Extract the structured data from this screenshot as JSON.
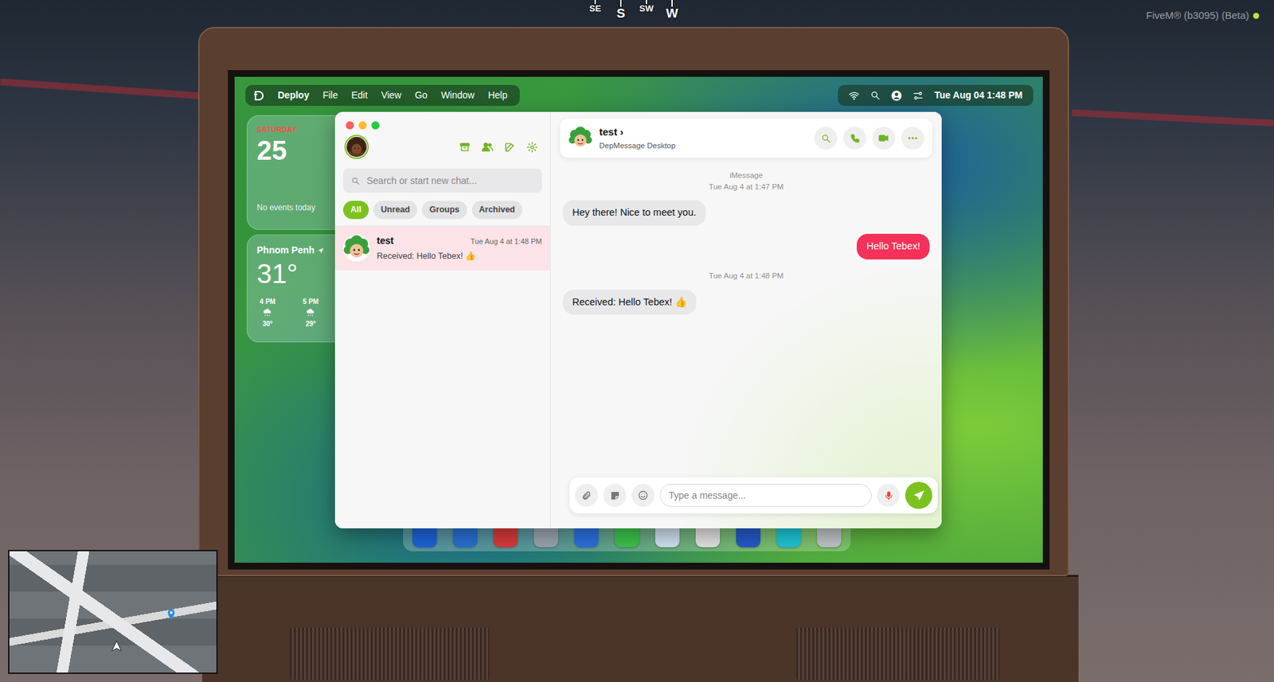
{
  "hud": {
    "compass": [
      {
        "label": "SE",
        "kind": "minor"
      },
      {
        "label": "S",
        "kind": "major"
      },
      {
        "label": "SW",
        "kind": "minor"
      },
      {
        "label": "W",
        "kind": "major"
      }
    ],
    "build": "FiveM® (b3095) (Beta)"
  },
  "menubar": {
    "app": "Deploy",
    "menus": [
      "File",
      "Edit",
      "View",
      "Go",
      "Window",
      "Help"
    ],
    "clock": "Tue Aug 04 1:48 PM"
  },
  "calendar": {
    "weekday": "SATURDAY",
    "day": "25",
    "events": "No events today"
  },
  "weather": {
    "city": "Phnom Penh",
    "temperature": "31°",
    "hours": [
      {
        "time": "4 PM",
        "temp": "30°"
      },
      {
        "time": "5 PM",
        "temp": "29°"
      }
    ]
  },
  "dock": [
    {
      "color": "#1c63d8"
    },
    {
      "color": "#2a6fd0"
    },
    {
      "color": "#d93a3a"
    },
    {
      "color": "#9aa3ad"
    },
    {
      "color": "#2b6fe0"
    },
    {
      "color": "#3bc34a"
    },
    {
      "color": "#cfe0f0"
    },
    {
      "color": "#e2e2e2"
    },
    {
      "color": "#2459c8"
    },
    {
      "color": "#1ec5d6"
    },
    {
      "color": "#bfc3c7"
    }
  ],
  "messenger": {
    "search": {
      "placeholder": "Search or start new chat..."
    },
    "filters": [
      {
        "label": "All",
        "selected": true
      },
      {
        "label": "Unread",
        "selected": false
      },
      {
        "label": "Groups",
        "selected": false
      },
      {
        "label": "Archived",
        "selected": false
      }
    ],
    "chats": [
      {
        "name": "test",
        "time": "Tue Aug 4 at 1:48 PM",
        "preview": "Received: Hello Tebex! 👍",
        "selected": true
      }
    ],
    "conversation": {
      "name": "test",
      "chevron": "›",
      "subtitle": "DepMessage Desktop",
      "messages": [
        {
          "kind": "timestamp",
          "lines": [
            "iMessage",
            "Tue Aug 4 at 1:47 PM"
          ]
        },
        {
          "kind": "incoming",
          "text": "Hey there! Nice to meet you."
        },
        {
          "kind": "outgoing",
          "text": "Hello Tebex!"
        },
        {
          "kind": "timestamp",
          "lines": [
            "Tue Aug 4 at 1:48 PM"
          ]
        },
        {
          "kind": "incoming",
          "text": "Received: Hello Tebex! 👍"
        }
      ]
    },
    "composer": {
      "placeholder": "Type a message..."
    }
  }
}
